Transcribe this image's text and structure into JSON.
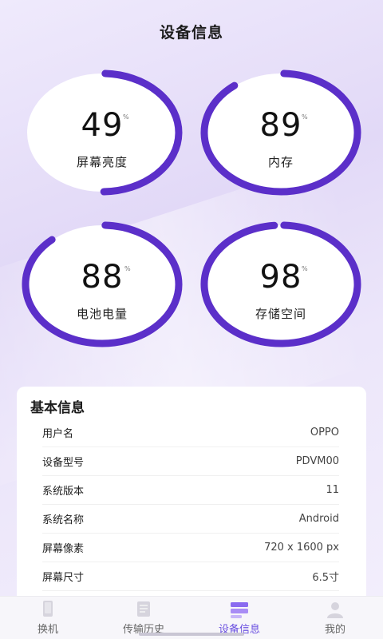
{
  "page": {
    "title": "设备信息"
  },
  "gauges": [
    {
      "value": "49",
      "unit": "%",
      "label": "屏幕亮度",
      "fraction": 0.49
    },
    {
      "value": "89",
      "unit": "%",
      "label": "内存",
      "fraction": 0.89
    },
    {
      "value": "88",
      "unit": "%",
      "label": "电池电量",
      "fraction": 0.88
    },
    {
      "value": "98",
      "unit": "%",
      "label": "存储空间",
      "fraction": 0.98
    }
  ],
  "info": {
    "title": "基本信息",
    "rows": [
      {
        "key": "用户名",
        "value": "OPPO"
      },
      {
        "key": "设备型号",
        "value": "PDVM00"
      },
      {
        "key": "系统版本",
        "value": "11"
      },
      {
        "key": "系统名称",
        "value": "Android"
      },
      {
        "key": "屏幕像素",
        "value": "720 x 1600 px"
      },
      {
        "key": "屏幕尺寸",
        "value": "6.5寸"
      }
    ]
  },
  "tabs": [
    {
      "label": "换机",
      "icon": "phone-icon"
    },
    {
      "label": "传输历史",
      "icon": "history-icon"
    },
    {
      "label": "设备信息",
      "icon": "device-info-icon",
      "active": true
    },
    {
      "label": "我的",
      "icon": "user-icon"
    }
  ],
  "colors": {
    "accent": "#5b2fc9",
    "tab_active": "#6a4fe0",
    "card": "#ffffff"
  }
}
